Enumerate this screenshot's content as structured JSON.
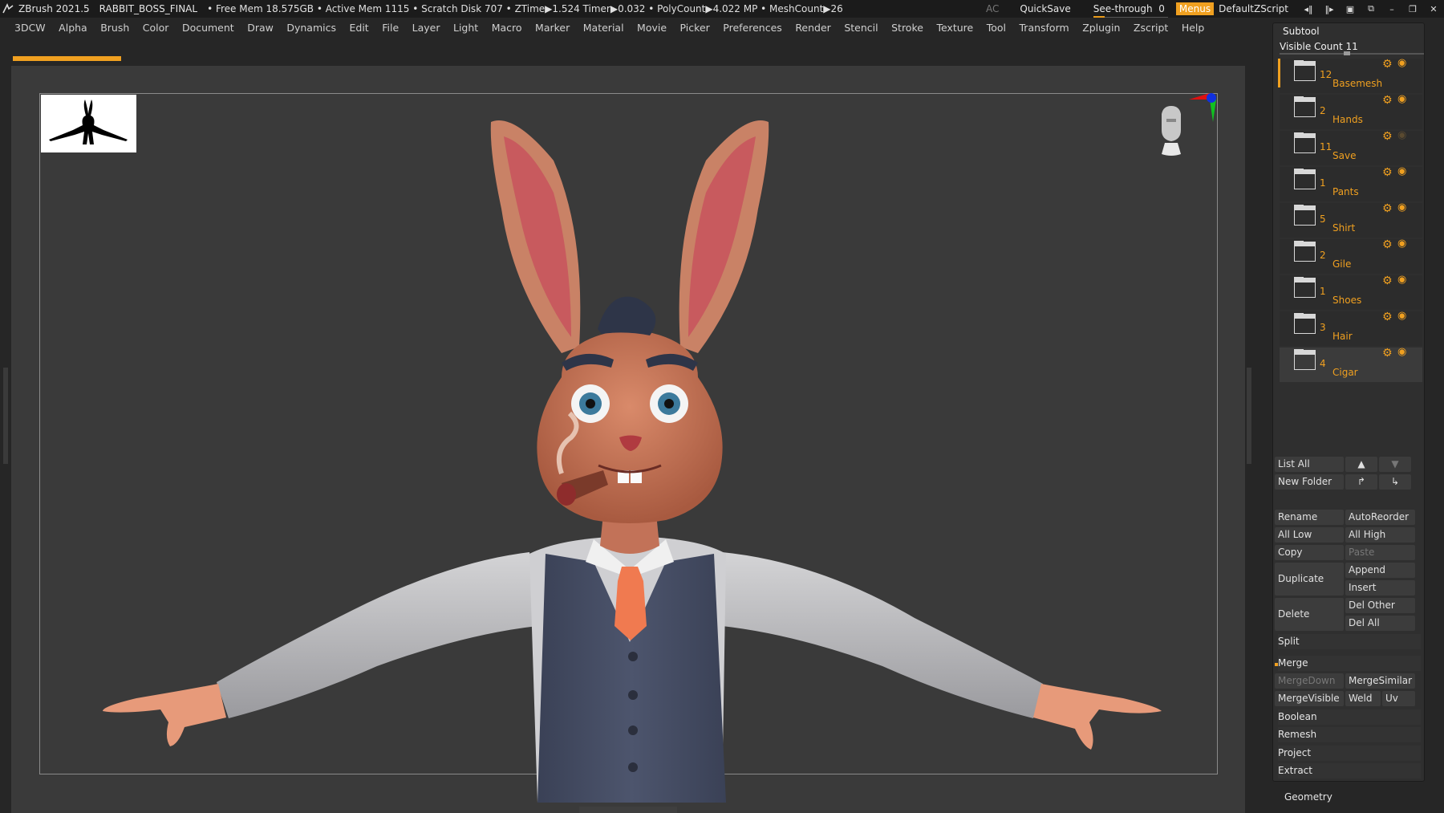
{
  "titlebar": {
    "app": "ZBrush 2021.5",
    "project": "RABBIT_BOSS_FINAL",
    "status": "• Free Mem 18.575GB • Active Mem 1115 • Scratch Disk 707 • ZTime▶1.524 Timer▶0.032 • PolyCount▶4.022 MP • MeshCount▶26",
    "ac": "AC",
    "quicksave": "QuickSave",
    "seethrough_label": "See-through",
    "seethrough_value": "0",
    "menus": "Menus",
    "script": "DefaultZScript"
  },
  "menubar": [
    "3DCW",
    "Alpha",
    "Brush",
    "Color",
    "Document",
    "Draw",
    "Dynamics",
    "Edit",
    "File",
    "Layer",
    "Light",
    "Macro",
    "Marker",
    "Material",
    "Movie",
    "Picker",
    "Preferences",
    "Render",
    "Stencil",
    "Stroke",
    "Texture",
    "Tool",
    "Transform",
    "Zplugin",
    "Zscript",
    "Help"
  ],
  "subtool": {
    "title": "Subtool",
    "visible_count_label": "Visible Count",
    "visible_count": "11",
    "items": [
      {
        "num": "12",
        "name": "Basemesh",
        "visible": true
      },
      {
        "num": "2",
        "name": "Hands",
        "visible": true
      },
      {
        "num": "11",
        "name": "Save",
        "visible": false
      },
      {
        "num": "1",
        "name": "Pants",
        "visible": true
      },
      {
        "num": "5",
        "name": "Shirt",
        "visible": true
      },
      {
        "num": "2",
        "name": "Gile",
        "visible": true
      },
      {
        "num": "1",
        "name": "Shoes",
        "visible": true
      },
      {
        "num": "3",
        "name": "Hair",
        "visible": true
      },
      {
        "num": "4",
        "name": "Cigar",
        "visible": true
      }
    ],
    "buttons": {
      "list_all": "List All",
      "new_folder": "New Folder",
      "rename": "Rename",
      "autoreorder": "AutoReorder",
      "all_low": "All Low",
      "all_high": "All High",
      "copy": "Copy",
      "paste": "Paste",
      "duplicate": "Duplicate",
      "append": "Append",
      "insert": "Insert",
      "delete": "Delete",
      "del_other": "Del Other",
      "del_all": "Del All",
      "split": "Split",
      "merge": "Merge",
      "merge_down": "MergeDown",
      "merge_similar": "MergeSimilar",
      "merge_visible": "MergeVisible",
      "weld": "Weld",
      "uv": "Uv",
      "boolean": "Boolean",
      "remesh": "Remesh",
      "project": "Project",
      "extract": "Extract"
    },
    "geometry": "Geometry"
  },
  "colors": {
    "accent": "#f0a020",
    "panel": "#2f2f2f",
    "canvas": "#3a3a3a"
  }
}
